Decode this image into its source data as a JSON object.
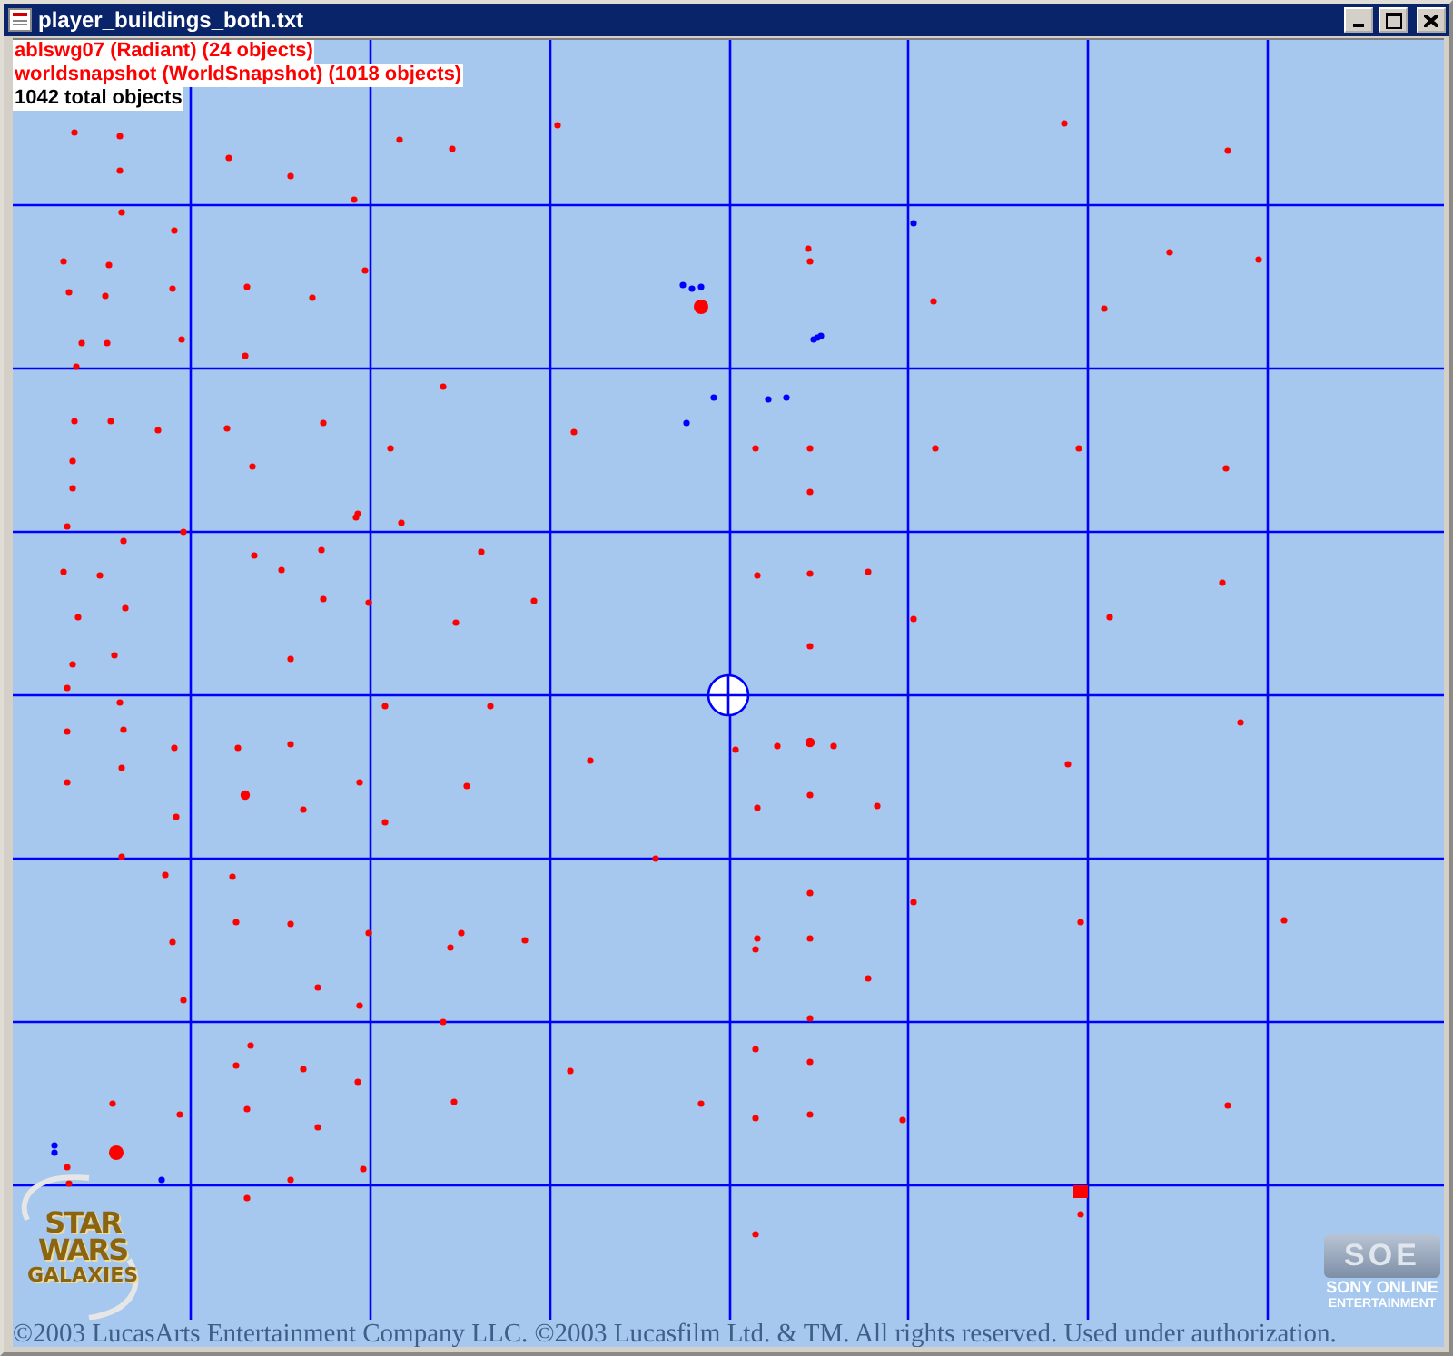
{
  "window": {
    "title": "player_buildings_both.txt"
  },
  "legend": {
    "layers": [
      {
        "label": "ablswg07 (Radiant) (24 objects)",
        "color": "#ff0000"
      },
      {
        "label": "worldsnapshot (WorldSnapshot) (1018 objects)",
        "color": "#ff0000"
      }
    ],
    "total": "1042 total objects"
  },
  "game_logo": {
    "lines": [
      "STAR",
      "WARS",
      "GALAXIES"
    ]
  },
  "publisher_logo": {
    "mark": "SOE",
    "lines": [
      "SONY ONLINE",
      "ENTERTAINMENT"
    ]
  },
  "copyright": "©2003 LucasArts Entertainment Company LLC. ©2003 Lucasfilm Ltd. & TM. All rights reserved. Used under authorization."
}
